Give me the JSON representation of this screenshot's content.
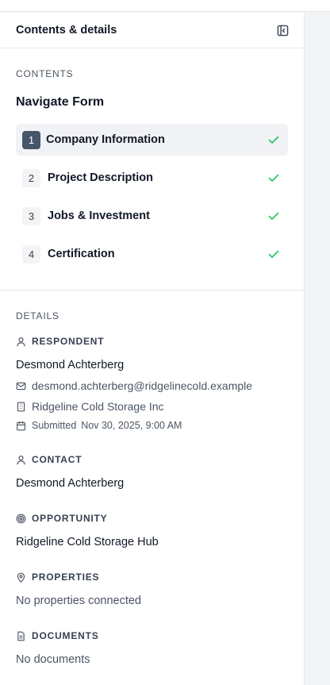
{
  "panel": {
    "title": "Contents & details",
    "collapse_icon": "panel-collapse-icon"
  },
  "contents": {
    "section_label": "CONTENTS",
    "nav_title": "Navigate Form",
    "items": [
      {
        "num": "1",
        "label": "Company Information",
        "completed": true,
        "active": true
      },
      {
        "num": "2",
        "label": "Project Description",
        "completed": true,
        "active": false
      },
      {
        "num": "3",
        "label": "Jobs & Investment",
        "completed": true,
        "active": false
      },
      {
        "num": "4",
        "label": "Certification",
        "completed": true,
        "active": false
      }
    ]
  },
  "details": {
    "section_label": "DETAILS",
    "respondent": {
      "label": "RESPONDENT",
      "name": "Desmond Achterberg",
      "email": "desmond.achterberg@ridgelinecold.example",
      "company": "Ridgeline Cold Storage Inc",
      "submitted_label": "Submitted",
      "submitted_value": "Nov 30, 2025, 9:00 AM"
    },
    "contact": {
      "label": "CONTACT",
      "name": "Desmond Achterberg"
    },
    "opportunity": {
      "label": "OPPORTUNITY",
      "name": "Ridgeline Cold Storage Hub"
    },
    "properties": {
      "label": "PROPERTIES",
      "empty": "No properties connected"
    },
    "documents": {
      "label": "DOCUMENTS",
      "empty": "No documents"
    }
  },
  "colors": {
    "check": "#22c55e",
    "active_badge": "#475569",
    "active_row": "#f1f2f5"
  }
}
